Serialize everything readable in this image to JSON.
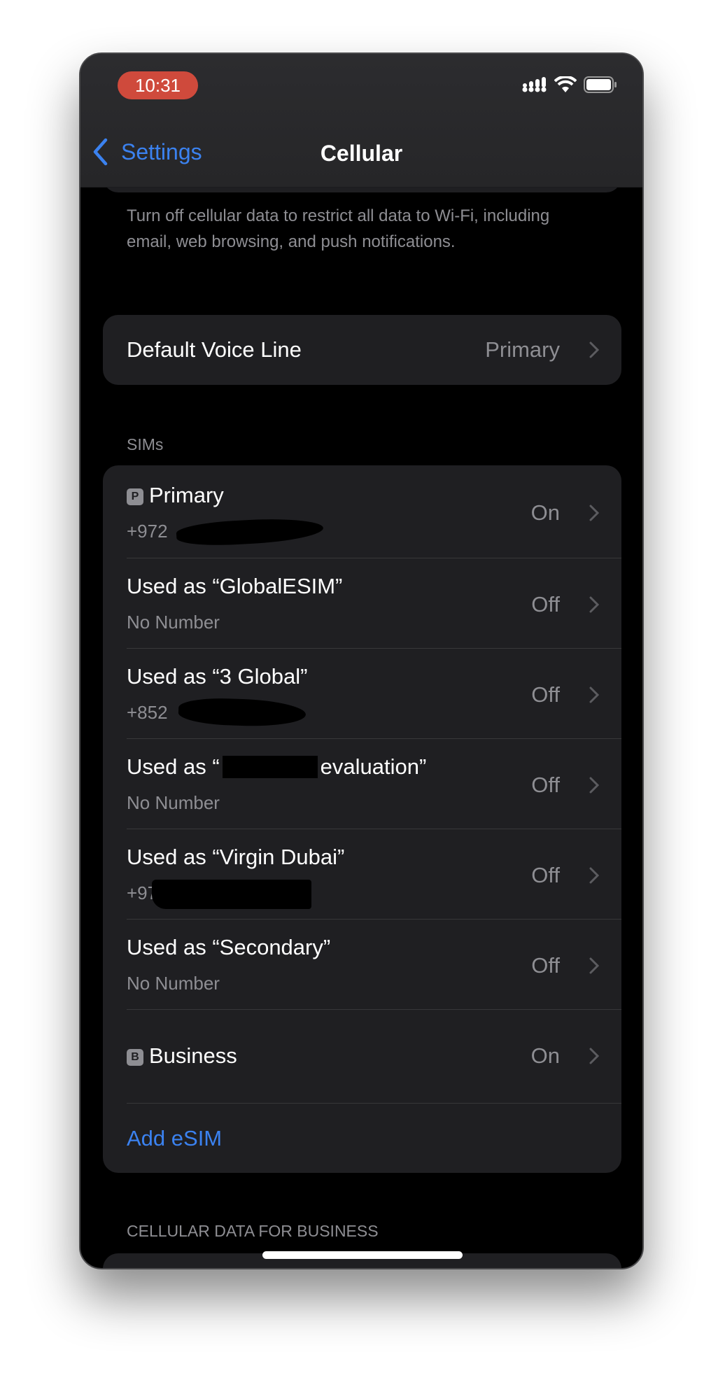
{
  "status_bar": {
    "time": "10:31",
    "icons": [
      "signal-icon",
      "wifi-icon",
      "battery-icon"
    ]
  },
  "nav": {
    "back_label": "Settings",
    "title": "Cellular"
  },
  "cellular_data_footer": "Turn off cellular data to restrict all data to Wi-Fi, including email, web browsing, and push notifications.",
  "default_voice_line": {
    "label": "Default Voice Line",
    "value": "Primary"
  },
  "sims": {
    "header": "SIMs",
    "items": [
      {
        "badge": "P",
        "label": "Primary",
        "sub": "+972",
        "value": "On"
      },
      {
        "label": "Used as “GlobalESIM”",
        "sub": "No Number",
        "value": "Off"
      },
      {
        "label": "Used as “3 Global”",
        "sub": "+852",
        "value": "Off"
      },
      {
        "label_prefix": "Used as “",
        "label_suffix": "evaluation”",
        "sub": "No Number",
        "value": "Off"
      },
      {
        "label": "Used as “Virgin Dubai”",
        "sub": "+971",
        "value": "Off"
      },
      {
        "label": "Used as “Secondary”",
        "sub": "No Number",
        "value": "Off"
      },
      {
        "badge": "B",
        "label": "Business",
        "value": "On"
      }
    ],
    "add_esim": "Add eSIM"
  },
  "business_header": "CELLULAR DATA FOR BUSINESS",
  "colors": {
    "accent": "#3b82f0",
    "time_pill": "#cf4a3c",
    "card": "#1f1f22",
    "secondary_text": "#8e8e93"
  }
}
